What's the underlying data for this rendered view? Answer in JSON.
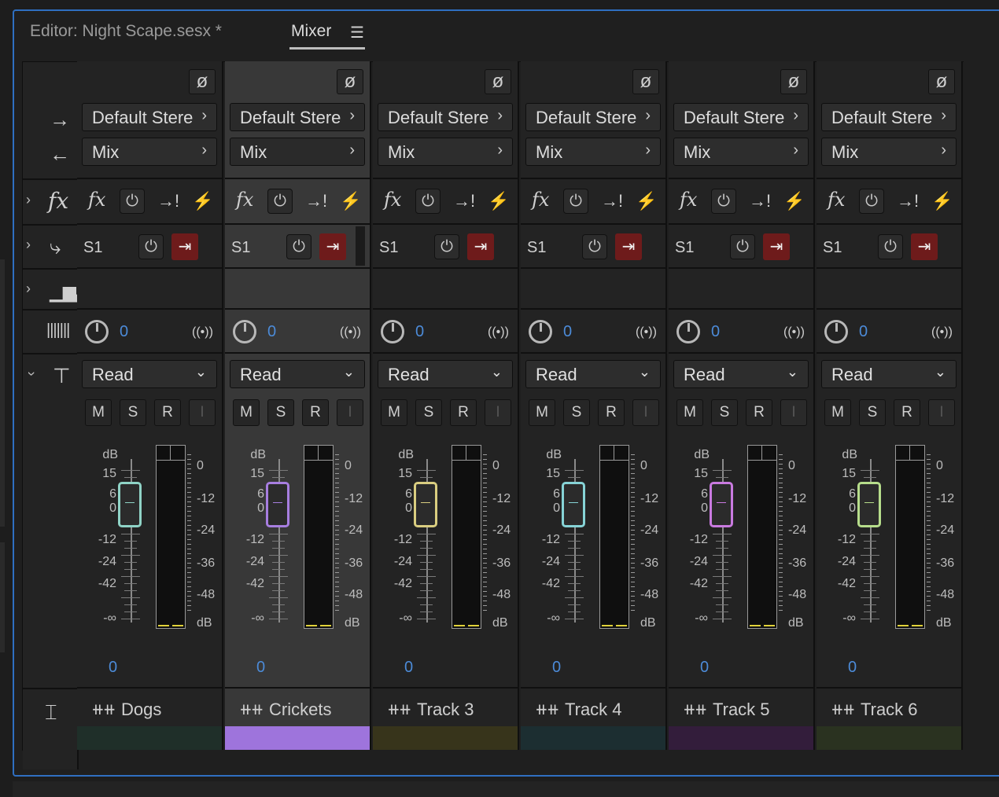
{
  "tabs": {
    "editor": "Editor: Night Scape.sesx *",
    "mixer": "Mixer",
    "menu_icon": "hamburger-menu-icon"
  },
  "meter_scale_left": [
    "dB",
    "15",
    "6",
    "0",
    "-12",
    "-24",
    "-42",
    "-∞"
  ],
  "meter_scale_right": [
    "0",
    "-12",
    "-24",
    "-36",
    "-48",
    "dB"
  ],
  "channels": [
    {
      "name": "Dogs",
      "output": "Default Stere",
      "input": "Mix",
      "send": "S1",
      "pan": "0",
      "automation": "Read",
      "m": "M",
      "s": "S",
      "r": "R",
      "i": "I",
      "volume": "0",
      "color": "#1f2f29",
      "fader_color": "#8fd3c6",
      "selected": false
    },
    {
      "name": "Crickets",
      "output": "Default Stere",
      "input": "Mix",
      "send": "S1",
      "pan": "0",
      "automation": "Read",
      "m": "M",
      "s": "S",
      "r": "R",
      "i": "I",
      "volume": "0",
      "color": "#9e74dc",
      "fader_color": "#a77ee0",
      "selected": true
    },
    {
      "name": "Track 3",
      "output": "Default Stere",
      "input": "Mix",
      "send": "S1",
      "pan": "0",
      "automation": "Read",
      "m": "M",
      "s": "S",
      "r": "R",
      "i": "I",
      "volume": "0",
      "color": "#37341b",
      "fader_color": "#d9cd80",
      "selected": false
    },
    {
      "name": "Track 4",
      "output": "Default Stere",
      "input": "Mix",
      "send": "S1",
      "pan": "0",
      "automation": "Read",
      "m": "M",
      "s": "S",
      "r": "R",
      "i": "I",
      "volume": "0",
      "color": "#1c2e31",
      "fader_color": "#86d3d6",
      "selected": false
    },
    {
      "name": "Track 5",
      "output": "Default Stere",
      "input": "Mix",
      "send": "S1",
      "pan": "0",
      "automation": "Read",
      "m": "M",
      "s": "S",
      "r": "R",
      "i": "I",
      "volume": "0",
      "color": "#331d3b",
      "fader_color": "#c97ae0",
      "selected": false
    },
    {
      "name": "Track 6",
      "output": "Default Stere",
      "input": "Mix",
      "send": "S1",
      "pan": "0",
      "automation": "Read",
      "m": "M",
      "s": "S",
      "r": "R",
      "i": "I",
      "volume": "0",
      "color": "#2a3220",
      "fader_color": "#b6dd8b",
      "selected": false
    }
  ]
}
